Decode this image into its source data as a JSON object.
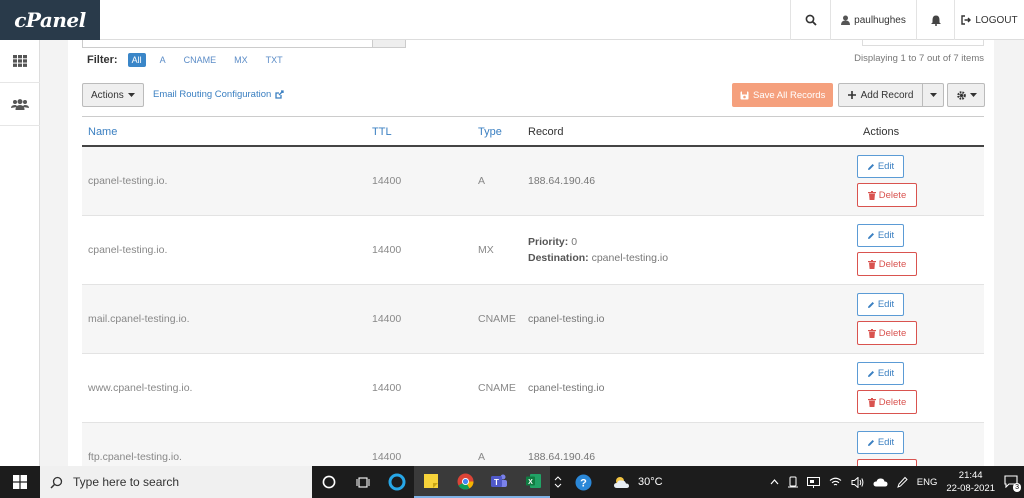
{
  "app": {
    "logo": "cPanel"
  },
  "topbar": {
    "username": "paulhughes",
    "logout_label": "LOGOUT"
  },
  "filter": {
    "label": "Filter:",
    "options": [
      "All",
      "A",
      "CNAME",
      "MX",
      "TXT"
    ],
    "active": "All"
  },
  "display_count": "Displaying 1 to 7 out of 7 items",
  "toolbar": {
    "actions_label": "Actions",
    "email_routing_label": "Email Routing Configuration",
    "save_all_label": "Save All Records",
    "add_record_label": "Add Record"
  },
  "table": {
    "headers": {
      "name": "Name",
      "ttl": "TTL",
      "type": "Type",
      "record": "Record",
      "actions": "Actions"
    },
    "edit_label": "Edit",
    "delete_label": "Delete",
    "rows": [
      {
        "name": "cpanel-testing.io.",
        "ttl": "14400",
        "type": "A",
        "record": "188.64.190.46"
      },
      {
        "name": "cpanel-testing.io.",
        "ttl": "14400",
        "type": "MX",
        "priority_label": "Priority:",
        "priority": "0",
        "destination_label": "Destination:",
        "destination": "cpanel-testing.io"
      },
      {
        "name": "mail.cpanel-testing.io.",
        "ttl": "14400",
        "type": "CNAME",
        "record": "cpanel-testing.io"
      },
      {
        "name": "www.cpanel-testing.io.",
        "ttl": "14400",
        "type": "CNAME",
        "record": "cpanel-testing.io"
      },
      {
        "name": "ftp.cpanel-testing.io.",
        "ttl": "14400",
        "type": "A",
        "record": "188.64.190.46"
      }
    ]
  },
  "taskbar": {
    "search_placeholder": "Type here to search",
    "temperature": "30°C",
    "language": "ENG",
    "time": "21:44",
    "date": "22-08-2021",
    "notification_count": "3"
  },
  "colors": {
    "accent": "#3a86c8",
    "save_button": "#f5a07d",
    "delete": "#d9534f",
    "logo_bg": "#293a4a"
  }
}
